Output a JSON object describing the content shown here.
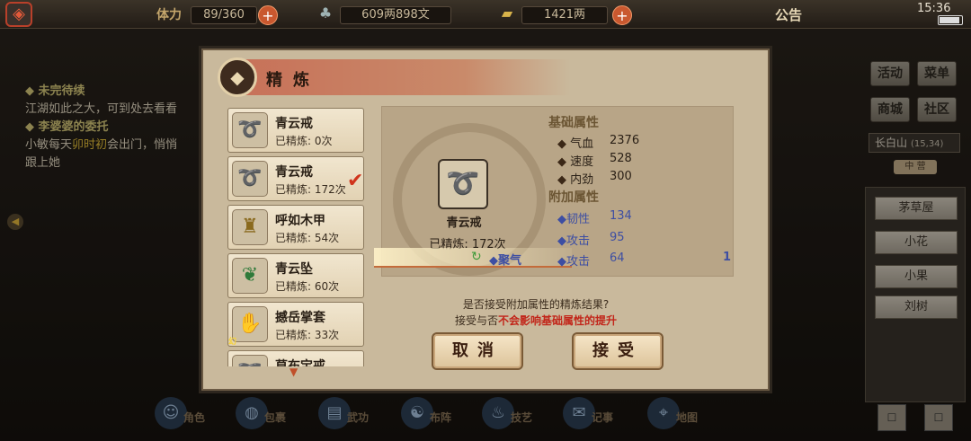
{
  "topbar": {
    "stamina_label": "体力",
    "stamina_value": "89/360",
    "money_value": "609两898文",
    "gold_value": "1421两",
    "notice": "公告",
    "clock": "15:36"
  },
  "quest": {
    "q1_title": "未完待续",
    "q1_text": "江湖如此之大，可到处去看看",
    "q2_title": "李婆婆的委托",
    "q2_text_a": "小敏每天",
    "q2_text_hl": "卯时初",
    "q2_text_b": "会出门，悄悄跟上她"
  },
  "right": {
    "buttons": [
      "活动",
      "菜单",
      "商城",
      "社区"
    ],
    "location": "长白山",
    "location_coord": "(15,34)",
    "location_sub": "中 营",
    "npcs": [
      "茅草屋",
      "小花",
      "小果",
      "刘树"
    ]
  },
  "bottom_nav": [
    "角色",
    "包裹",
    "武功",
    "布阵",
    "技艺",
    "记事",
    "地图"
  ],
  "dialog": {
    "title": "精炼",
    "items": [
      {
        "name": "青云戒",
        "count": "已精炼: 0次",
        "icon": "ring-icon"
      },
      {
        "name": "青云戒",
        "count": "已精炼: 172次",
        "icon": "ring-icon",
        "selected": true
      },
      {
        "name": "呼如木甲",
        "count": "已精炼: 54次",
        "icon": "armor-icon"
      },
      {
        "name": "青云坠",
        "count": "已精炼: 60次",
        "icon": "pendant-icon"
      },
      {
        "name": "撼岳掌套",
        "count": "已精炼: 33次",
        "icon": "glove-icon",
        "tag": "幻"
      },
      {
        "name": "草布宝戒",
        "count": "",
        "icon": "ring-icon"
      }
    ],
    "selected_item_name": "青云戒",
    "selected_item_count": "已精炼: 172次",
    "base_attr_title": "基础属性",
    "base_attrs": [
      {
        "label": "气血",
        "value": "2376"
      },
      {
        "label": "速度",
        "value": "528"
      },
      {
        "label": "内劲",
        "value": "300"
      }
    ],
    "extra_attr_title": "附加属性",
    "extra_attrs": [
      {
        "label": "韧性",
        "value": "134"
      },
      {
        "label": "攻击",
        "value": "95"
      },
      {
        "label": "攻击",
        "value": "64"
      }
    ],
    "new_attr_name": "聚气",
    "new_attr_value": "1",
    "question_line1": "是否接受附加属性的精炼结果?",
    "question_line2_a": "接受与否",
    "question_line2_red": "不会影响基础属性的提升",
    "cancel_label": "取消",
    "accept_label": "接受"
  }
}
